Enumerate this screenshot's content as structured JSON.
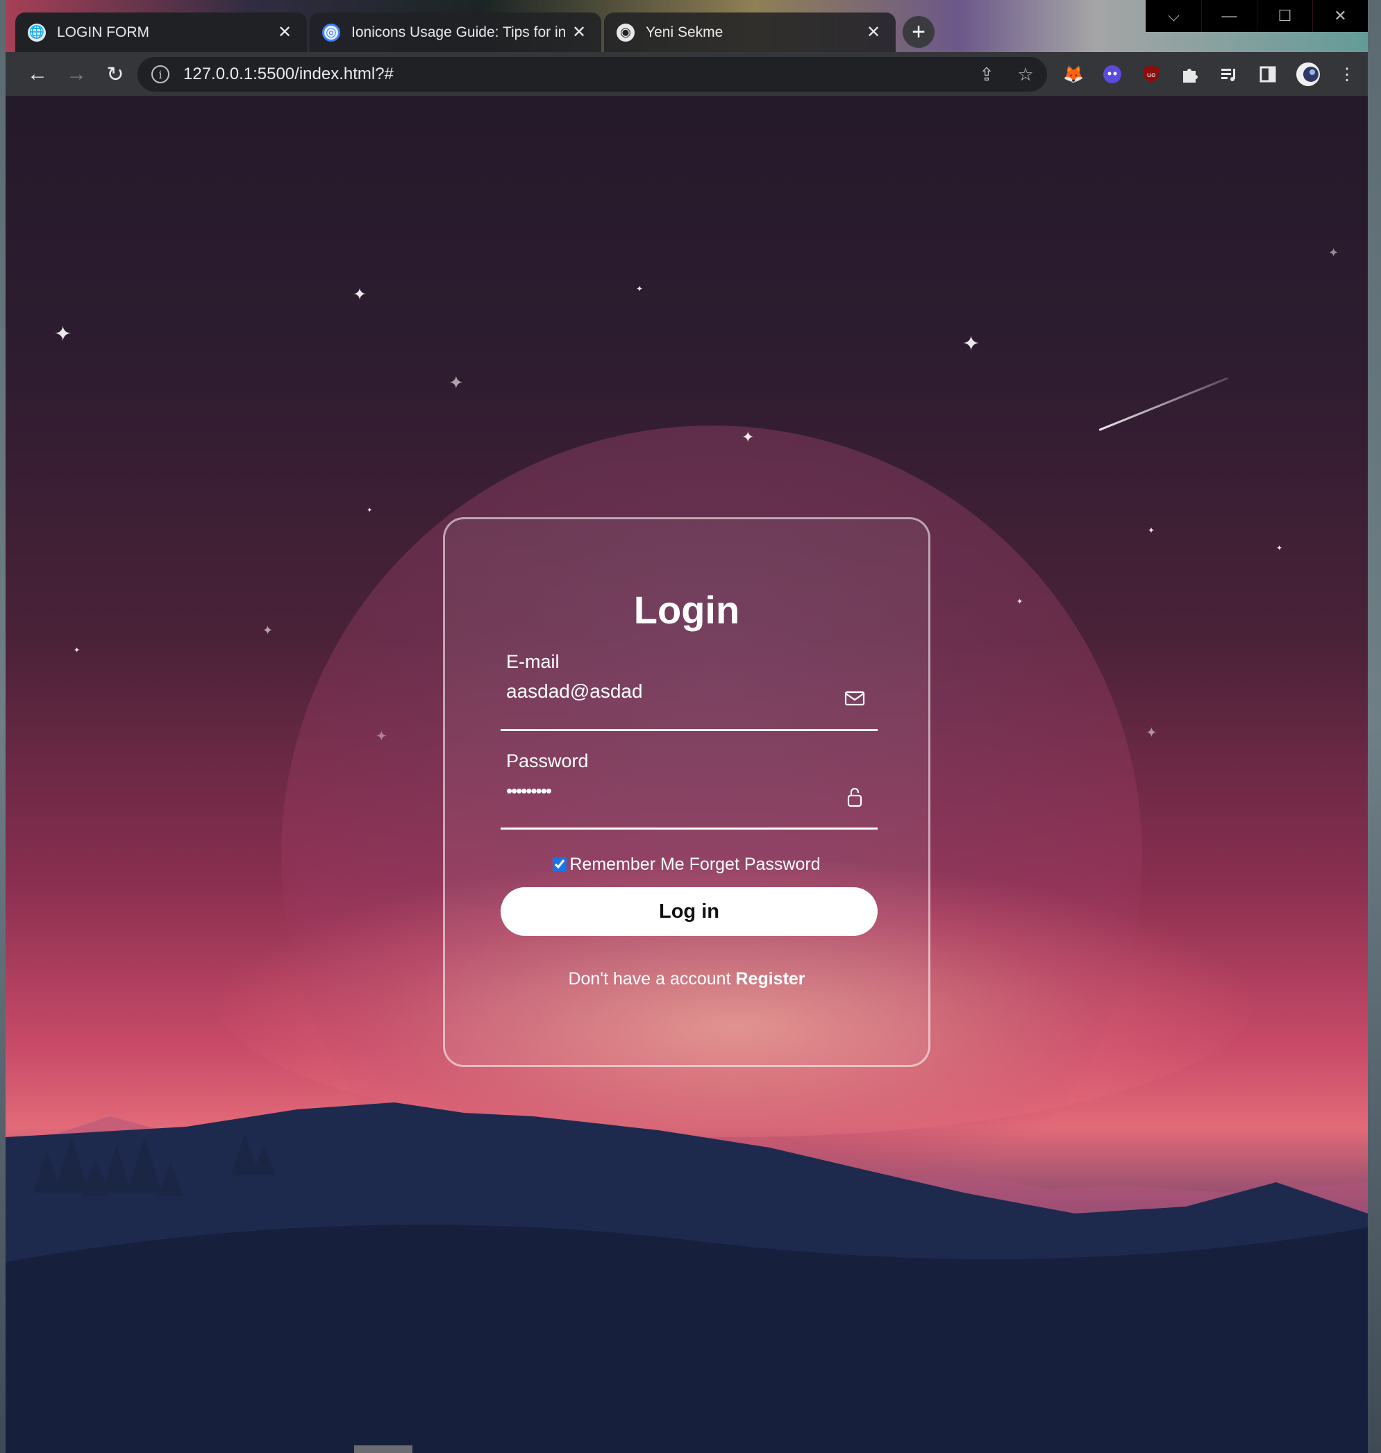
{
  "browser": {
    "tabs": [
      {
        "title": "LOGIN FORM",
        "close": "✕",
        "active": true
      },
      {
        "title": "Ionicons Usage Guide: Tips for in",
        "close": "✕",
        "active": false
      },
      {
        "title": "Yeni Sekme",
        "close": "✕",
        "active": false
      }
    ],
    "new_tab": "+",
    "address_bar": {
      "url": "127.0.0.1:5500/index.html?#"
    },
    "window_controls": {
      "dropdown": "⌵",
      "minimize": "—",
      "maximize": "☐",
      "close": "✕"
    }
  },
  "login": {
    "title": "Login",
    "email": {
      "label": "E-mail",
      "value": "aasdad@asdad"
    },
    "password": {
      "label": "Password",
      "value": "•••••••••"
    },
    "remember": {
      "label": "Remember Me Forget Password",
      "checked": true
    },
    "submit_label": "Log in",
    "register": {
      "prompt": "Don't have a account",
      "link": "Register"
    }
  },
  "colors": {
    "card_border": "#ffffff",
    "button_bg": "#ffffff",
    "accent": "#1a73e8"
  }
}
